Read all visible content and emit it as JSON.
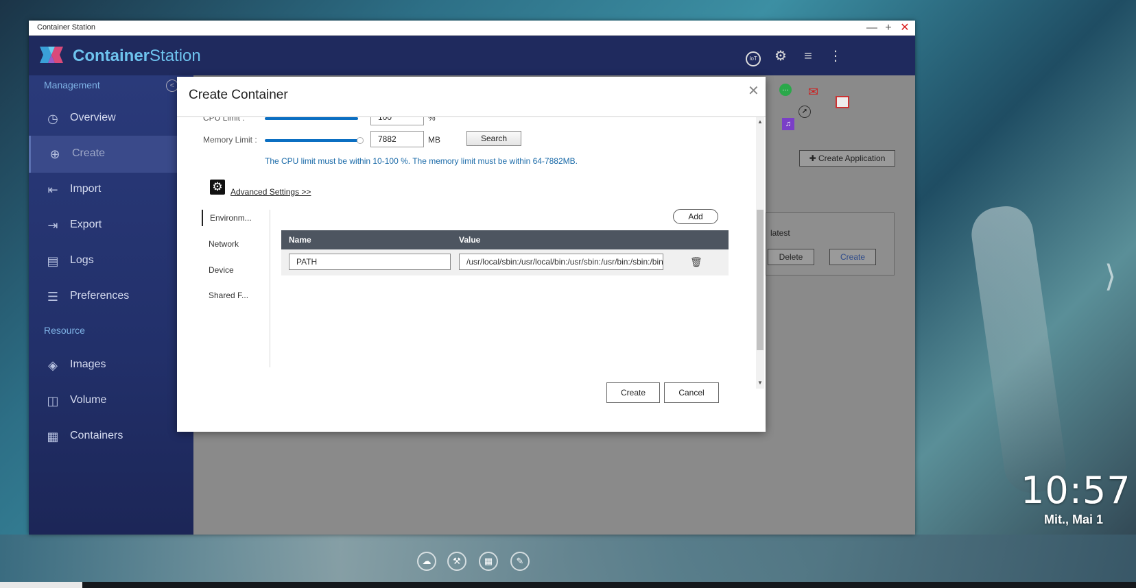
{
  "window": {
    "title": "Container Station",
    "brand_a": "Container",
    "brand_b": "Station"
  },
  "header_icons": [
    "iot-icon",
    "gear-icon",
    "stack-icon",
    "kebab-icon"
  ],
  "header_icon_labels": {
    "iot": "IoT"
  },
  "sidebar": {
    "section_management": "Management",
    "section_resource": "Resource",
    "items": [
      {
        "label": "Overview",
        "icon": "gauge-icon"
      },
      {
        "label": "Create",
        "icon": "plus-circle-icon"
      },
      {
        "label": "Import",
        "icon": "import-icon"
      },
      {
        "label": "Export",
        "icon": "export-icon"
      },
      {
        "label": "Logs",
        "icon": "document-icon"
      },
      {
        "label": "Preferences",
        "icon": "sliders-icon"
      },
      {
        "label": "Images",
        "icon": "layers-icon"
      },
      {
        "label": "Volume",
        "icon": "cylinder-icon"
      },
      {
        "label": "Containers",
        "icon": "cube-icon"
      }
    ],
    "active": "Create"
  },
  "background": {
    "create_application": "Create Application",
    "tag": "latest",
    "delete": "Delete",
    "create": "Create"
  },
  "modal": {
    "title": "Create Container",
    "cpu_label": "CPU Limit :",
    "cpu_value": "100",
    "cpu_unit": "%",
    "memory_label": "Memory Limit :",
    "memory_value": "7882",
    "memory_unit": "MB",
    "search": "Search",
    "hint": "The CPU limit must be within 10-100 %. The memory limit must be within 64-7882MB.",
    "advanced": "Advanced Settings >>",
    "tabs": [
      "Environm...",
      "Network",
      "Device",
      "Shared F..."
    ],
    "active_tab": "Environm...",
    "add": "Add",
    "table": {
      "col_name": "Name",
      "col_value": "Value",
      "rows": [
        {
          "name": "PATH",
          "value": "/usr/local/sbin:/usr/local/bin:/usr/sbin:/usr/bin:/sbin:/bin"
        }
      ]
    },
    "create": "Create",
    "cancel": "Cancel"
  },
  "desktop": {
    "time": "10:57",
    "date": "Mit., Mai 1"
  }
}
